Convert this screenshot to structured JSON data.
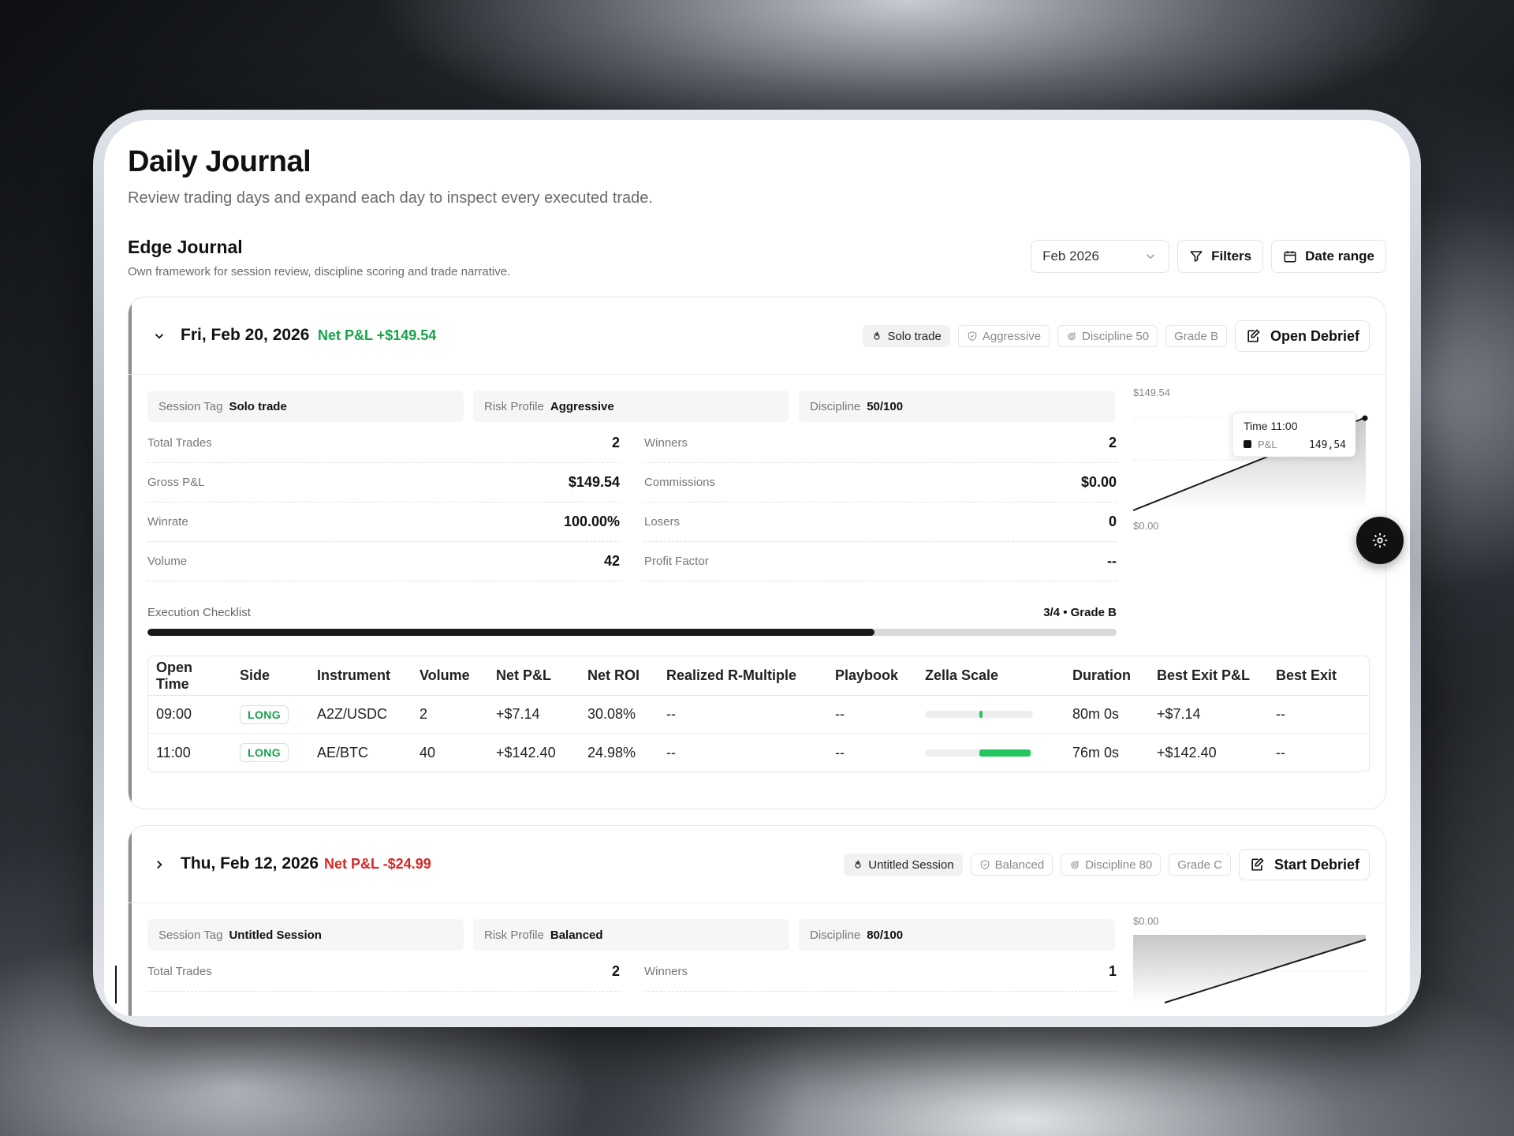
{
  "header": {
    "title": "Daily Journal",
    "subtitle": "Review trading days and expand each day to inspect every executed trade."
  },
  "section": {
    "title": "Edge Journal",
    "subtitle": "Own framework for session review, discipline scoring and trade narrative."
  },
  "toolbar": {
    "month": "Feb 2026",
    "filters_label": "Filters",
    "date_range_label": "Date range"
  },
  "days": [
    {
      "date": "Fri, Feb 20, 2026",
      "net_pnl": "Net P&L +$149.54",
      "pnl_positive": true,
      "chips": {
        "session": "Solo trade",
        "risk": "Aggressive",
        "discipline": "Discipline 50",
        "grade": "Grade B"
      },
      "debrief_label": "Open Debrief",
      "tags": {
        "session_key": "Session Tag",
        "session_val": "Solo trade",
        "risk_key": "Risk Profile",
        "risk_val": "Aggressive",
        "discipline_key": "Discipline",
        "discipline_val": "50/100"
      },
      "stats": {
        "total_trades_label": "Total Trades",
        "total_trades": "2",
        "winners_label": "Winners",
        "winners": "2",
        "gross_pnl_label": "Gross P&L",
        "gross_pnl": "$149.54",
        "commissions_label": "Commissions",
        "commissions": "$0.00",
        "winrate_label": "Winrate",
        "winrate": "100.00%",
        "losers_label": "Losers",
        "losers": "0",
        "volume_label": "Volume",
        "volume": "42",
        "profit_factor_label": "Profit Factor",
        "profit_factor": "--"
      },
      "checklist": {
        "label": "Execution Checklist",
        "value": "3/4 • Grade B",
        "progress": 0.75
      },
      "chart": {
        "top_label": "$149.54",
        "bottom_label": "$0.00",
        "tooltip_title": "Time 11:00",
        "tooltip_series": "P&L",
        "tooltip_value": "149,54"
      },
      "table": {
        "columns": [
          "Open Time",
          "Side",
          "Instrument",
          "Volume",
          "Net P&L",
          "Net ROI",
          "Realized R-Multiple",
          "Playbook",
          "Zella Scale",
          "Duration",
          "Best Exit P&L",
          "Best Exit"
        ],
        "rows": [
          {
            "open_time": "09:00",
            "side": "LONG",
            "instrument": "A2Z/USDC",
            "volume": "2",
            "net_pnl": "+$7.14",
            "net_roi": "30.08%",
            "r_multiple": "--",
            "playbook": "--",
            "zella": 0.03,
            "duration": "80m 0s",
            "best_exit_pnl": "+$7.14",
            "best_exit": "--"
          },
          {
            "open_time": "11:00",
            "side": "LONG",
            "instrument": "AE/BTC",
            "volume": "40",
            "net_pnl": "+$142.40",
            "net_roi": "24.98%",
            "r_multiple": "--",
            "playbook": "--",
            "zella": 0.95,
            "duration": "76m 0s",
            "best_exit_pnl": "+$142.40",
            "best_exit": "--"
          }
        ]
      }
    },
    {
      "date": "Thu, Feb 12, 2026",
      "net_pnl": "Net P&L -$24.99",
      "pnl_positive": false,
      "chips": {
        "session": "Untitled Session",
        "risk": "Balanced",
        "discipline": "Discipline 80",
        "grade": "Grade C"
      },
      "debrief_label": "Start Debrief",
      "tags": {
        "session_key": "Session Tag",
        "session_val": "Untitled Session",
        "risk_key": "Risk Profile",
        "risk_val": "Balanced",
        "discipline_key": "Discipline",
        "discipline_val": "80/100"
      },
      "stats": {
        "total_trades_label": "Total Trades",
        "total_trades": "2",
        "winners_label": "Winners",
        "winners": "1"
      },
      "chart": {
        "top_label": "$0.00"
      }
    }
  ],
  "colors": {
    "positive": "#16a34a",
    "negative": "#dc2626",
    "accent": "#22c55e",
    "ink": "#111111"
  },
  "icons": [
    "chevron-down-icon",
    "filter-icon",
    "calendar-icon",
    "chevron-right-icon",
    "flame-icon",
    "shield-icon",
    "target-icon",
    "edit-icon",
    "gear-icon"
  ]
}
